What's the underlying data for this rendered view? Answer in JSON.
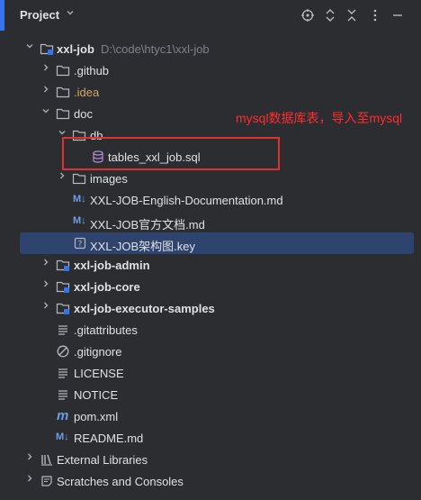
{
  "header": {
    "title": "Project",
    "title_icon": "chevron-down-icon",
    "actions": [
      "crosshair-icon",
      "expand-collapse-icon",
      "close-icon",
      "more-icon"
    ]
  },
  "tree": {
    "root": {
      "name": "xxl-job",
      "path": "D:\\code\\htyc1\\xxl-job"
    },
    "github": ".github",
    "idea": ".idea",
    "doc": "doc",
    "db": "db",
    "sql_file": "tables_xxl_job.sql",
    "images": "images",
    "md_tag": "M↓",
    "english_doc": "XXL-JOB-English-Documentation.md",
    "official_doc": "XXL-JOB官方文档.md",
    "key_file": "XXL-JOB架构图.key",
    "admin": "xxl-job-admin",
    "core": "xxl-job-core",
    "samples": "xxl-job-executor-samples",
    "gitattributes": ".gitattributes",
    "gitignore": ".gitignore",
    "license": "LICENSE",
    "notice": "NOTICE",
    "m_tag": "m",
    "pom": "pom.xml",
    "readme": "README.md",
    "external": "External Libraries",
    "scratches": "Scratches and Consoles"
  },
  "annotation": {
    "text": "mysql数据库表，导入至mysql",
    "color": "#ff2d2d"
  },
  "colors": {
    "background": "#2b2d30",
    "selection": "#2e436e",
    "accent": "#3574f0",
    "excluded_folder": "#d5a563"
  }
}
